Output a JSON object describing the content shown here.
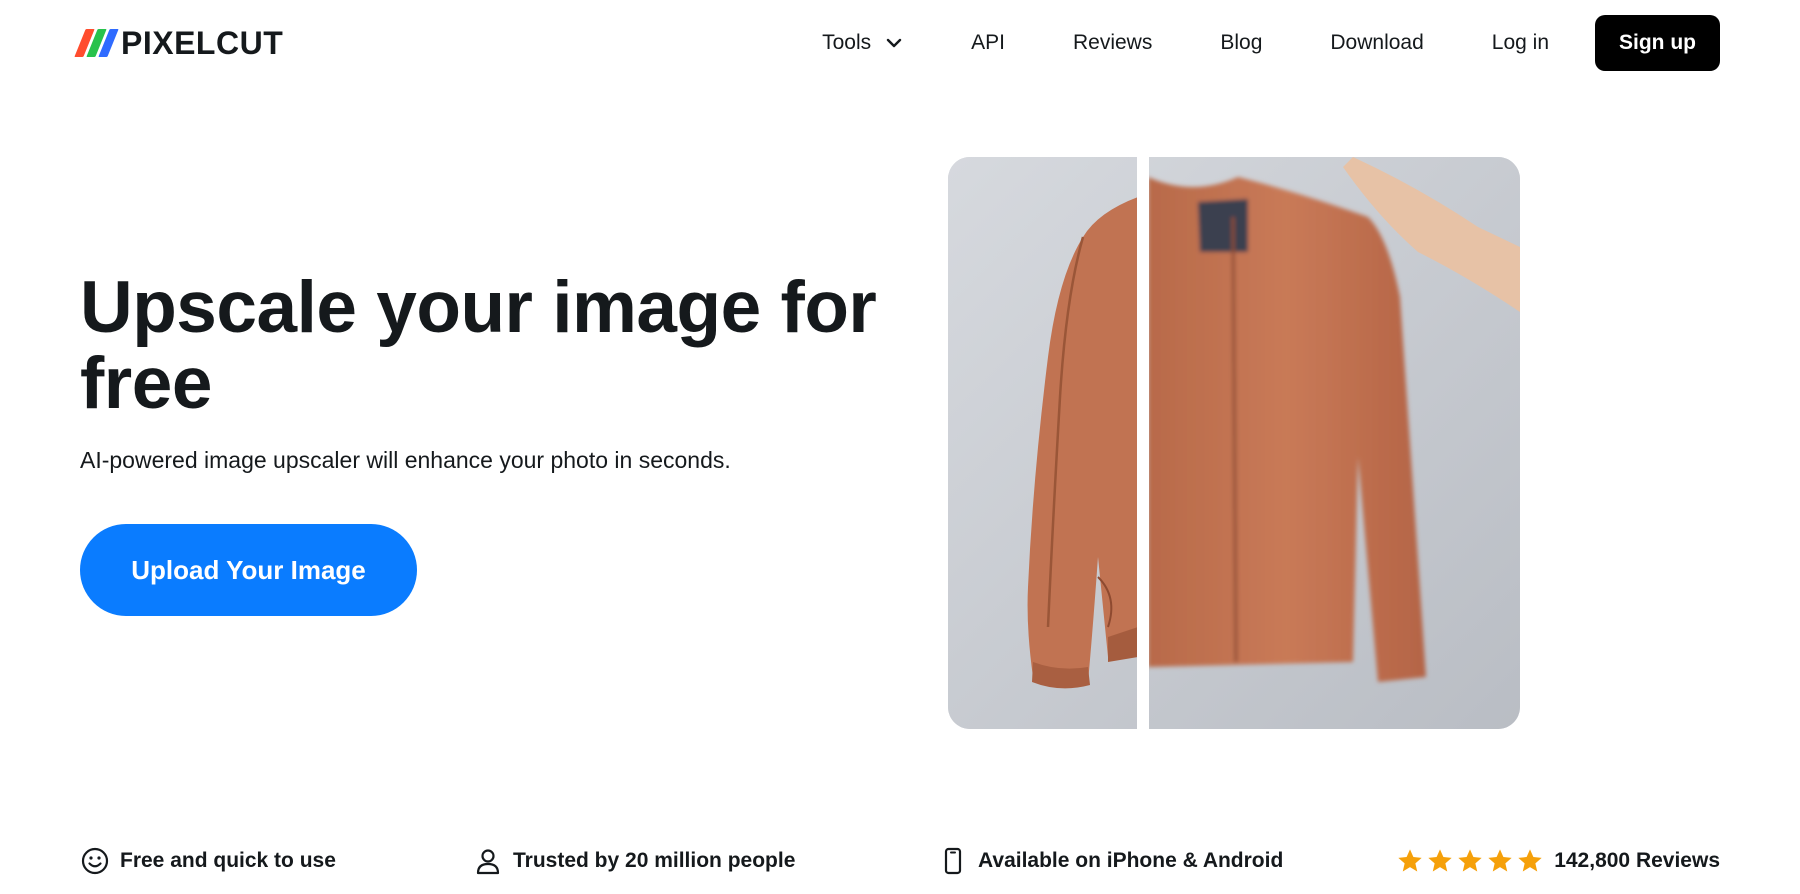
{
  "brand": {
    "name": "PIXELCUT",
    "mark_colors": [
      "#ff4d2e",
      "#27c24c",
      "#2f6bff"
    ]
  },
  "nav": {
    "tools": "Tools",
    "api": "API",
    "reviews": "Reviews",
    "blog": "Blog",
    "download": "Download",
    "login": "Log in",
    "signup": "Sign up"
  },
  "hero": {
    "title": "Upscale your image for free",
    "subtitle": "AI-powered image upscaler will enhance your photo in seconds.",
    "cta": "Upload Your Image",
    "cta_color": "#0a7cff"
  },
  "features": {
    "free": {
      "icon": "smile-icon",
      "label": "Free and quick to use"
    },
    "trusted": {
      "icon": "user-icon",
      "label": "Trusted by 20 million people"
    },
    "available": {
      "icon": "phone-icon",
      "label": "Available on iPhone & Android"
    },
    "reviews": {
      "icon": "star-icon",
      "label": "142,800 Reviews",
      "rating": 5,
      "star_color": "#f5a00a"
    }
  }
}
